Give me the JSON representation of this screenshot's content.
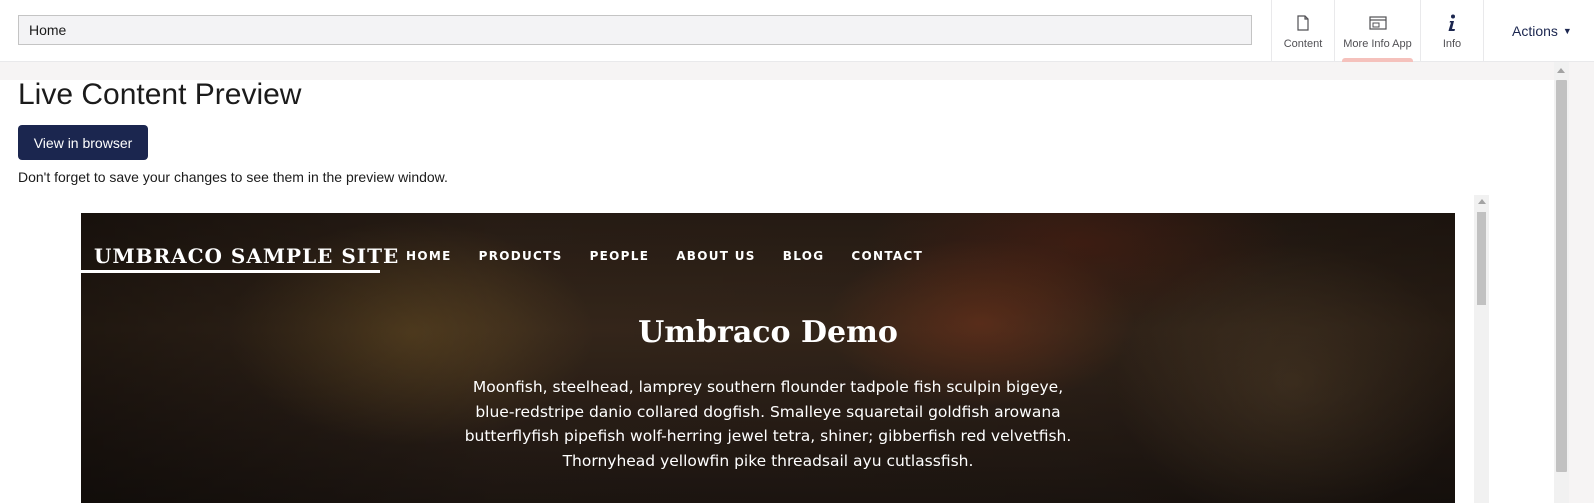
{
  "header": {
    "name_value": "Home",
    "apps": [
      {
        "label": "Content",
        "icon": "document-icon"
      },
      {
        "label": "More Info App",
        "icon": "window-icon",
        "active": true
      },
      {
        "label": "Info",
        "icon": "info-icon"
      }
    ],
    "actions_label": "Actions"
  },
  "main": {
    "title": "Live Content Preview",
    "view_button": "View in browser",
    "note": "Don't forget to save your changes to see them in the preview window."
  },
  "site": {
    "logo": "UMBRACO SAMPLE SITE",
    "nav": [
      "HOME",
      "PRODUCTS",
      "PEOPLE",
      "ABOUT US",
      "BLOG",
      "CONTACT"
    ],
    "hero_title": "Umbraco Demo",
    "hero_text": "Moonfish, steelhead, lamprey southern flounder tadpole fish sculpin bigeye, blue-redstripe danio collared dogfish. Smalleye squaretail goldfish arowana butterflyfish pipefish wolf-herring jewel tetra, shiner; gibberfish red velvetfish. Thornyhead yellowfin pike threadsail ayu cutlassfish."
  },
  "colors": {
    "primary": "#1b264f",
    "active_tab_indicator": "#f5c1bc",
    "background": "#f6f4f4"
  }
}
